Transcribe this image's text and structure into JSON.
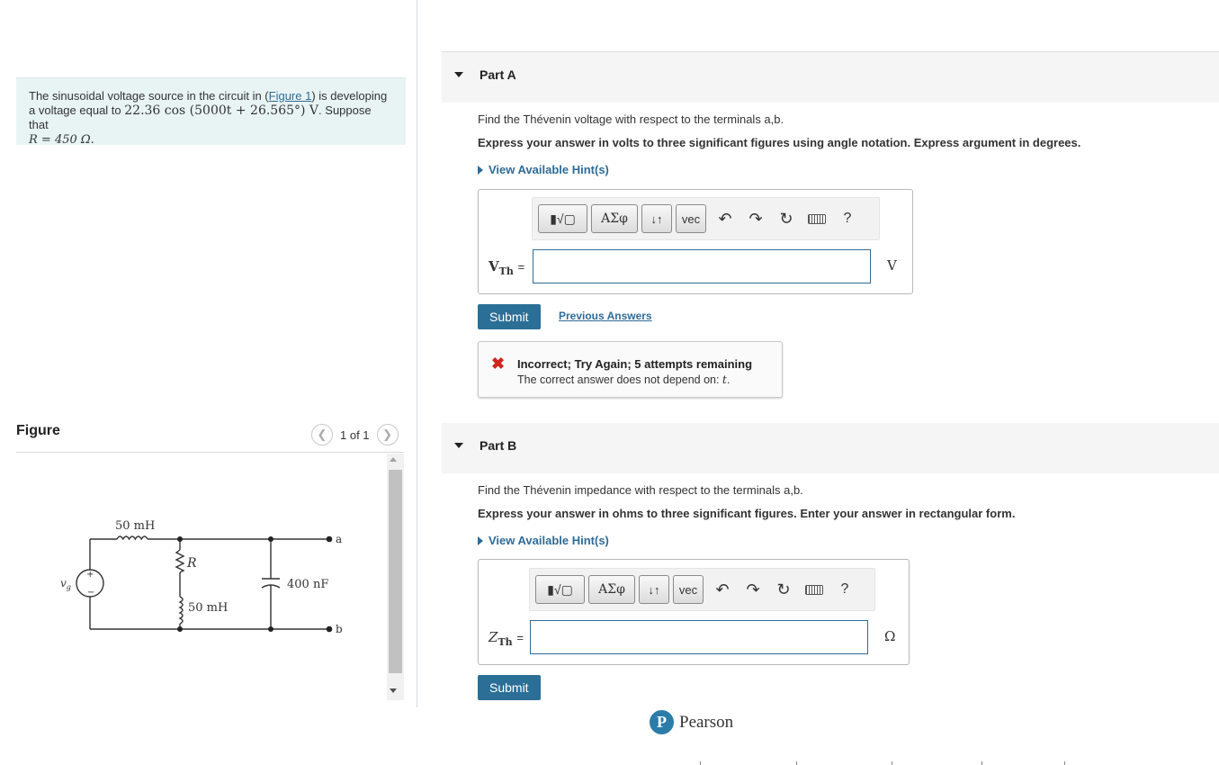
{
  "problem": {
    "text_before": "The sinusoidal voltage source in the circuit in (",
    "figure_link": "Figure 1",
    "text_after": ") is developing a voltage equal to ",
    "voltage_expr": "22.36 cos (5000t + 26.565°) V",
    "text_suppose": ". Suppose that",
    "r_expr": "R = 450 Ω."
  },
  "figure": {
    "title": "Figure",
    "pager": "1 of 1",
    "labels": {
      "inductor1": "50 mH",
      "resistor": "R",
      "inductor2": "50 mH",
      "capacitor": "400 nF",
      "terminal_a": "a",
      "terminal_b": "b",
      "source": "v",
      "source_sub": "g"
    }
  },
  "partA": {
    "title": "Part A",
    "question": "Find the Thévenin voltage with respect to the terminals a,b.",
    "instruction": "Express your answer in volts to three significant figures using angle notation. Express argument in degrees.",
    "hint": "View Available Hint(s)",
    "toolbar": {
      "templates": "▮√▢",
      "greek": "ΑΣφ",
      "updown": "↓↑",
      "vec": "vec",
      "help": "?"
    },
    "var_main": "V",
    "var_sub": "Th",
    "eq": "=",
    "input_value": "",
    "unit": "V",
    "submit": "Submit",
    "previous": "Previous Answers",
    "feedback": {
      "status": "Incorrect; Try Again; 5 attempts remaining",
      "detail_prefix": "The correct answer does not depend on: ",
      "detail_var": "t",
      "detail_suffix": "."
    }
  },
  "partB": {
    "title": "Part B",
    "question": "Find the Thévenin impedance with respect to the terminals a,b.",
    "instruction": "Express your answer in ohms to three significant figures. Enter your answer in rectangular form.",
    "hint": "View Available Hint(s)",
    "toolbar": {
      "templates": "▮√▢",
      "greek": "ΑΣφ",
      "updown": "↓↑",
      "vec": "vec",
      "help": "?"
    },
    "var_main": "Z",
    "var_sub": "Th",
    "eq": "=",
    "input_value": "",
    "unit": "Ω",
    "submit": "Submit"
  },
  "footer": {
    "brand_letter": "P",
    "brand": "Pearson"
  },
  "colors": {
    "accent": "#2b6f97",
    "problem_bg": "#e8f4f4",
    "error": "#d0271d"
  }
}
